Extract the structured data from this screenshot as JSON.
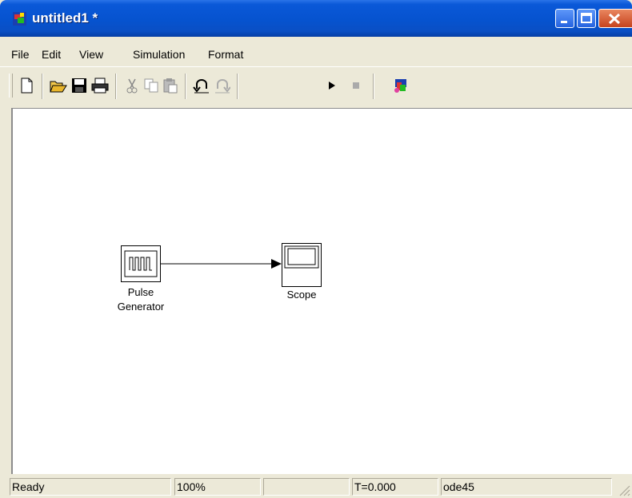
{
  "window": {
    "title": "untitled1 *"
  },
  "menu": {
    "items": [
      "File",
      "Edit",
      "View",
      "Simulation",
      "Format"
    ]
  },
  "toolbar": {
    "icons": [
      "new-icon",
      "open-icon",
      "save-icon",
      "print-icon",
      "cut-icon",
      "copy-icon",
      "paste-icon",
      "undo-icon",
      "redo-icon",
      "start-simulation-icon",
      "stop-simulation-icon",
      "library-browser-icon"
    ]
  },
  "blocks": {
    "pulse": {
      "label_line1": "Pulse",
      "label_line2": "Generator"
    },
    "scope": {
      "label": "Scope"
    }
  },
  "status": {
    "state": "Ready",
    "zoom": "100%",
    "time": "T=0.000",
    "solver": "ode45"
  }
}
